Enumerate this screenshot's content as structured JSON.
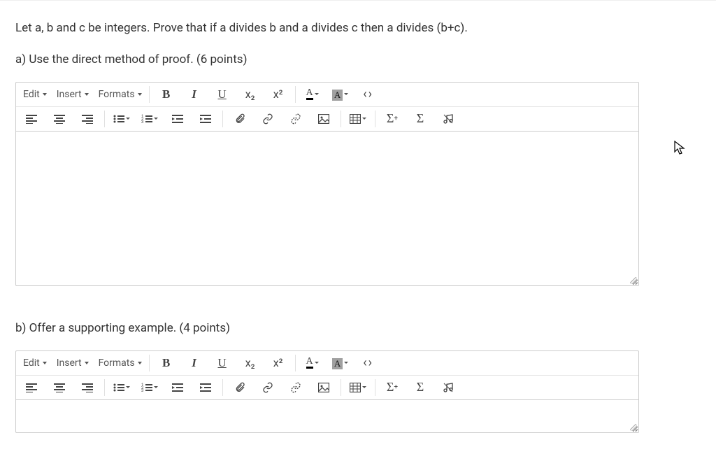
{
  "question": {
    "prompt": "Let a, b and c be integers. Prove that if a divides b and a divides c then a divides (b+c).",
    "partA": "a) Use the direct method of proof. (6 points)",
    "partB": "b) Offer a supporting example. (4 points)"
  },
  "editor": {
    "menus": {
      "edit": "Edit",
      "insert": "Insert",
      "formats": "Formats"
    },
    "icons": {
      "bold": "B",
      "italic": "I",
      "underline": "U",
      "sub": "x₂",
      "sup": "x²",
      "textcolor": "A",
      "bgcolor": "A",
      "code": "‹›",
      "alignLeft": "align-left",
      "alignCenter": "align-center",
      "alignRight": "align-right",
      "bullet": "bullet-list",
      "numbered": "numbered-list",
      "outdent": "outdent",
      "indent": "indent",
      "attach": "attachment",
      "link": "link",
      "unlink": "unlink",
      "image": "image",
      "table": "table",
      "sigmaPlus": "Σ",
      "sigma": "Σ",
      "music": "music"
    }
  }
}
